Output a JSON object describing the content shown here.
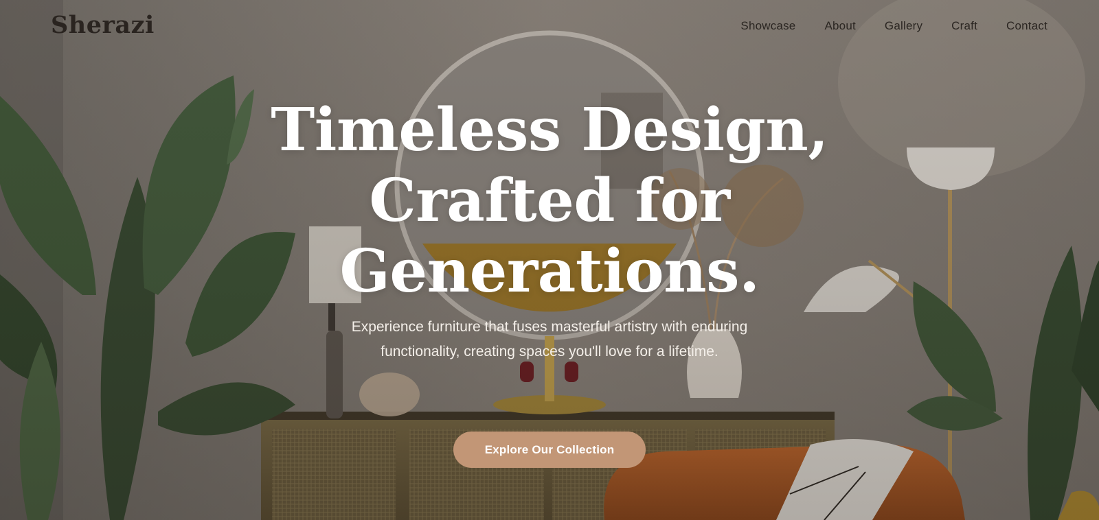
{
  "brand": {
    "logo": "Sherazi"
  },
  "nav": {
    "items": [
      {
        "label": "Showcase"
      },
      {
        "label": "About"
      },
      {
        "label": "Gallery"
      },
      {
        "label": "Craft"
      },
      {
        "label": "Contact"
      }
    ]
  },
  "hero": {
    "headline": [
      "Timeless Design,",
      "Crafted for",
      "Generations."
    ],
    "subtitle": [
      "Experience furniture that fuses masterful artistry with enduring",
      "functionality, creating spaces you'll love for a lifetime."
    ],
    "cta_label": "Explore Our Collection"
  },
  "colors": {
    "accent": "#c29676",
    "nav_text": "#2b2622",
    "headline": "#ffffff"
  }
}
